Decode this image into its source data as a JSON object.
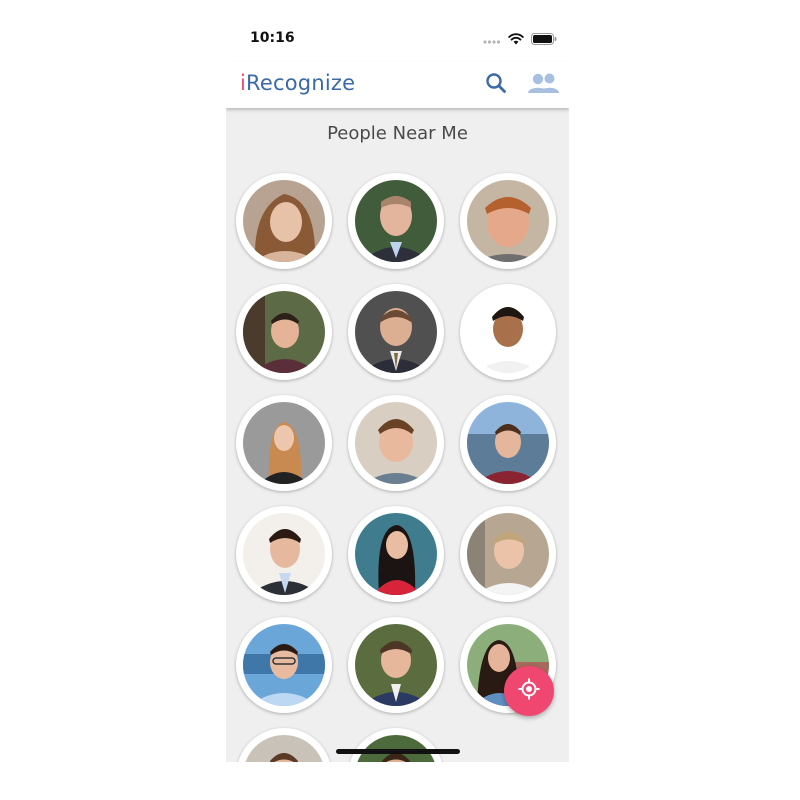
{
  "status_bar": {
    "time": "10:16"
  },
  "app_bar": {
    "title_accent": "i",
    "title_rest": "Recognize",
    "search_icon": "search-icon",
    "people_icon": "people-icon"
  },
  "section_title": "People Near Me",
  "colors": {
    "brand_blue": "#3b6aa6",
    "accent_pink": "#e94f72",
    "fab": "#ef476f",
    "background": "#efefef"
  },
  "people_count_visible": 17,
  "fab": {
    "icon": "my-location-icon"
  }
}
